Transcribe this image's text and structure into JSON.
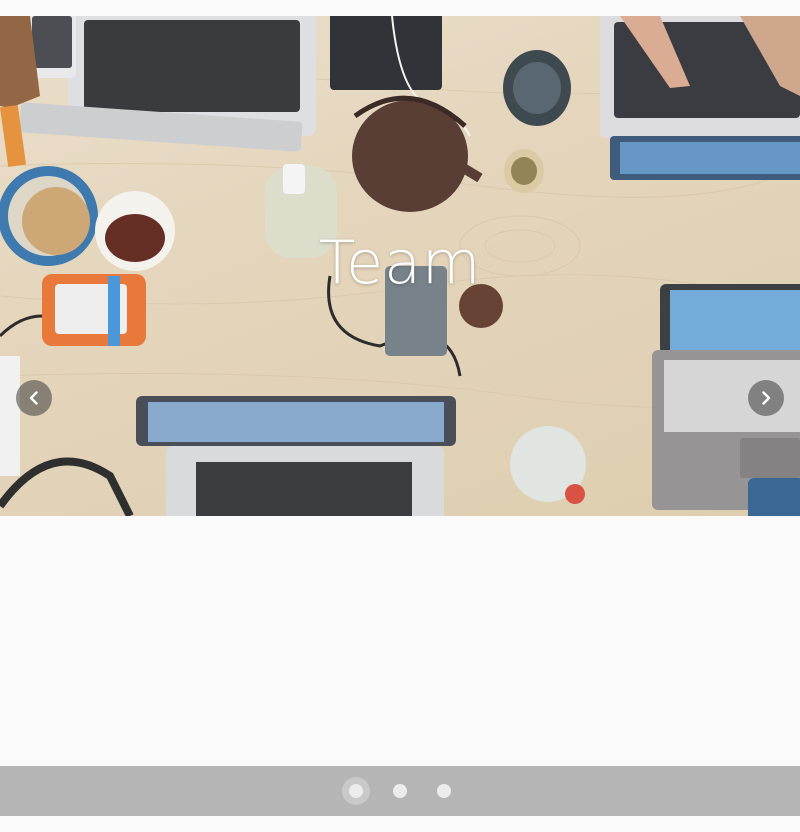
{
  "carousel": {
    "slide_title": "Team",
    "prev_icon": "chevron-left-icon",
    "next_icon": "chevron-right-icon",
    "indicators": [
      {
        "active": true
      },
      {
        "active": false
      },
      {
        "active": false
      }
    ]
  },
  "colors": {
    "background": "#fafafa",
    "footer_bar": "#b5b5b5",
    "indicator_dot": "#ececec",
    "indicator_active_halo": "#c9c9c9",
    "title_text": "#ffffff"
  }
}
